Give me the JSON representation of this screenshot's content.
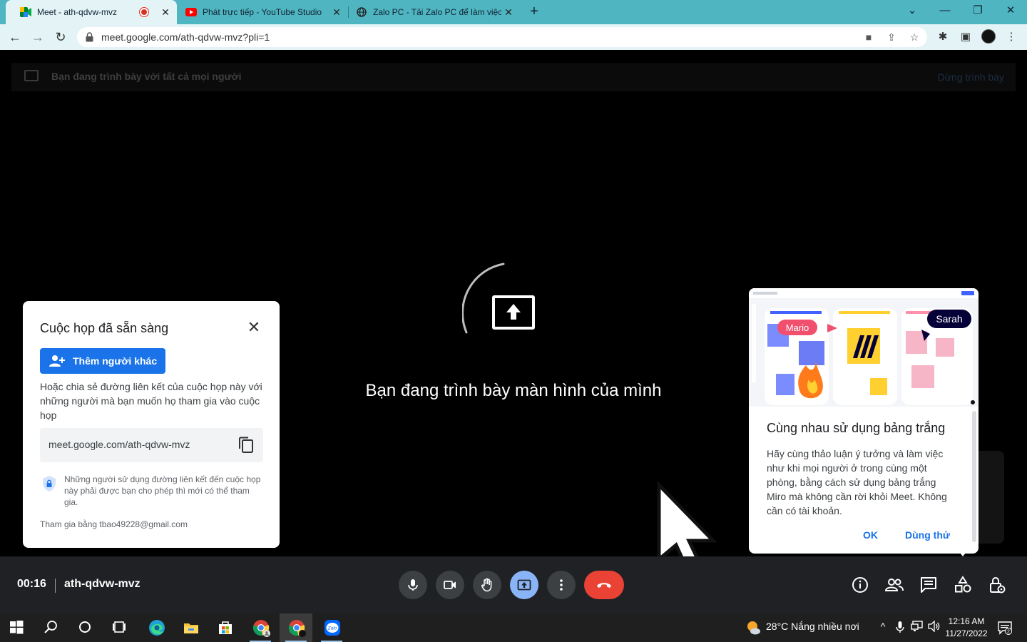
{
  "browser": {
    "tabs": [
      {
        "title": "Meet - ath-qdvw-mvz",
        "favicon": "google-meet-icon",
        "recording": true
      },
      {
        "title": "Phát trực tiếp - YouTube Studio",
        "favicon": "youtube-icon"
      },
      {
        "title": "Zalo PC - Tải Zalo PC để làm việc",
        "favicon": "globe-icon"
      }
    ],
    "url": "meet.google.com/ath-qdvw-mvz?pli=1"
  },
  "meet": {
    "presenting_bar": {
      "text": "Bạn đang trình bày với tất cả mọi người",
      "stop_label": "Dừng trình bày"
    },
    "center_message": "Bạn đang trình bày màn hình của mình",
    "ready_card": {
      "title": "Cuộc họp đã sẵn sàng",
      "add_button": "Thêm người khác",
      "description": "Hoặc chia sẻ đường liên kết của cuộc họp này với những người mà bạn muốn họ tham gia vào cuộc họp",
      "meeting_link": "meet.google.com/ath-qdvw-mvz",
      "security_note": "Những người sử dụng đường liên kết đến cuộc họp này phải được bạn cho phép thì mới có thể tham gia.",
      "joined_as": "Tham gia bằng tbao49228@gmail.com"
    },
    "whiteboard_card": {
      "illustration_labels": {
        "left_user": "Mario",
        "right_user": "Sarah"
      },
      "title": "Cùng nhau sử dụng bảng trắng",
      "description": "Hãy cùng thảo luận ý tưởng và làm việc như khi mọi người ở trong cùng một phòng, bằng cách sử dụng bảng trắng Miro mà không cần rời khỏi Meet. Không cần có tài khoản.",
      "ok_label": "OK",
      "try_label": "Dùng thử"
    },
    "bottom_bar": {
      "time": "00:16",
      "meeting_code": "ath-qdvw-mvz",
      "controls": [
        "microphone-icon",
        "camera-icon",
        "raise-hand-icon",
        "present-screen-icon",
        "more-options-icon",
        "end-call-icon"
      ],
      "right_controls": [
        "info-icon",
        "people-icon",
        "chat-icon",
        "activities-icon",
        "host-controls-icon"
      ]
    }
  },
  "taskbar": {
    "weather": "28°C  Nắng nhiều nơi",
    "time": "12:16 AM",
    "date": "11/27/2022",
    "notification_count": "2"
  },
  "colors": {
    "chrome_tabbar": "#4fb5c1",
    "meet_blue": "#1a73e8",
    "end_call_red": "#ea4335",
    "active_control": "#8ab4f8"
  }
}
